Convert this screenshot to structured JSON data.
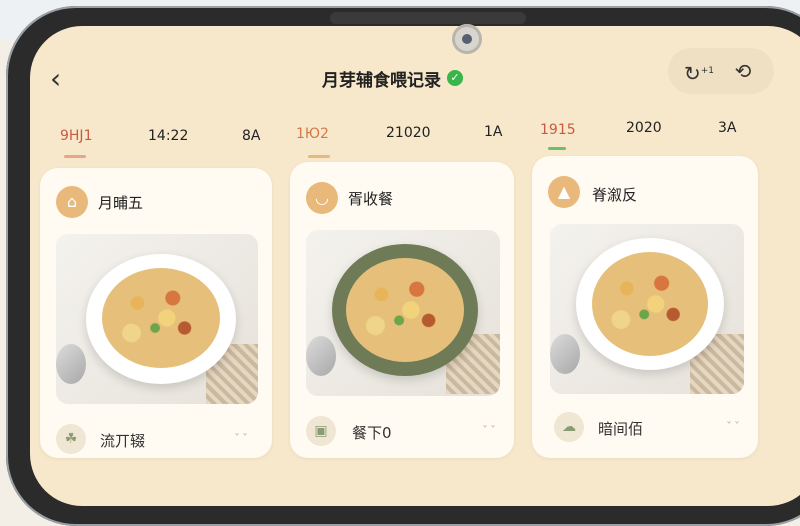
{
  "header": {
    "title": "月芽辅食喂记录",
    "back_icon": "back-arrow-icon",
    "verified_icon": "check-icon"
  },
  "actions": {
    "add_icon": "add-timer-icon",
    "sync_icon": "sync-icon",
    "add_label": "+1"
  },
  "date_tabs": [
    {
      "label": "9HJ1",
      "color": "#c95a42"
    },
    {
      "label": "14:22"
    },
    {
      "label": "8A"
    },
    {
      "label": "1Ю2",
      "color": "#d27a4a"
    },
    {
      "label": "21020"
    },
    {
      "label": "1A"
    },
    {
      "label": "1915",
      "color": "#c95a42"
    },
    {
      "label": "2020"
    },
    {
      "label": "3A"
    }
  ],
  "cards": [
    {
      "title": "月晡五",
      "icon": "chef-hat-icon",
      "bottom_label": "流丌辍",
      "bowl_color": "#ffffff"
    },
    {
      "title": "胥收餐",
      "icon": "bowl-icon",
      "bottom_label": "餐下0",
      "bowl_color": "#6f7a56"
    },
    {
      "title": "脊溆反",
      "icon": "drop-icon",
      "bottom_label": "暗间佰",
      "bowl_color": "#ffffff"
    }
  ],
  "colors": {
    "screen_bg": "#f7e8cb",
    "card_bg": "#fffaf2",
    "accent_orange": "#e9b97b",
    "check_green": "#39b54a"
  }
}
